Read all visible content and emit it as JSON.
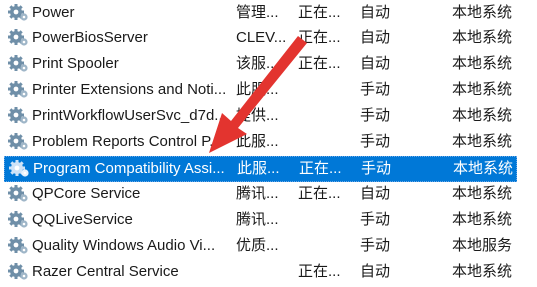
{
  "services": [
    {
      "name": "Power",
      "desc": "管理...",
      "status": "正在...",
      "startup": "自动",
      "logon": "本地系统",
      "selected": false
    },
    {
      "name": "PowerBiosServer",
      "desc": "CLEV...",
      "status": "正在...",
      "startup": "自动",
      "logon": "本地系统",
      "selected": false
    },
    {
      "name": "Print Spooler",
      "desc": "该服...",
      "status": "正在...",
      "startup": "自动",
      "logon": "本地系统",
      "selected": false
    },
    {
      "name": "Printer Extensions and Noti...",
      "desc": "此服...",
      "status": "",
      "startup": "手动",
      "logon": "本地系统",
      "selected": false
    },
    {
      "name": "PrintWorkflowUserSvc_d7d...",
      "desc": "提供...",
      "status": "",
      "startup": "手动",
      "logon": "本地系统",
      "selected": false
    },
    {
      "name": "Problem Reports Control P...",
      "desc": "此服...",
      "status": "",
      "startup": "手动",
      "logon": "本地系统",
      "selected": false
    },
    {
      "name": "Program Compatibility Assi...",
      "desc": "此服...",
      "status": "正在...",
      "startup": "手动",
      "logon": "本地系统",
      "selected": true
    },
    {
      "name": "QPCore Service",
      "desc": "腾讯...",
      "status": "正在...",
      "startup": "自动",
      "logon": "本地系统",
      "selected": false
    },
    {
      "name": "QQLiveService",
      "desc": "腾讯...",
      "status": "",
      "startup": "手动",
      "logon": "本地系统",
      "selected": false
    },
    {
      "name": "Quality Windows Audio Vi...",
      "desc": "优质...",
      "status": "",
      "startup": "手动",
      "logon": "本地服务",
      "selected": false
    },
    {
      "name": "Razer Central Service",
      "desc": "",
      "status": "正在...",
      "startup": "自动",
      "logon": "本地系统",
      "selected": false
    }
  ],
  "icon": "gear-icon",
  "colors": {
    "selection": "#0078d7",
    "arrow": "#e3342f"
  }
}
